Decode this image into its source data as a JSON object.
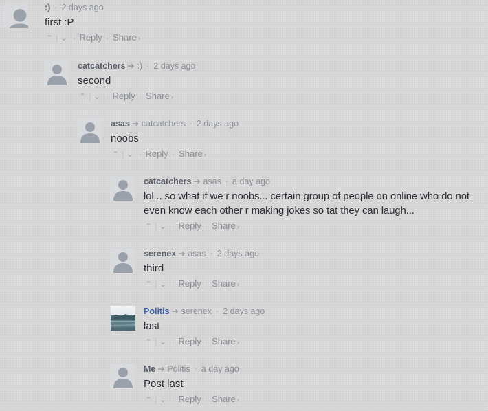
{
  "comments": [
    {
      "author": ":)",
      "in_reply_to": "",
      "time": "2 days ago",
      "text": "first :P",
      "reply": "Reply",
      "share": "Share",
      "avatar": "default"
    },
    {
      "author": "catcatchers",
      "in_reply_to": ":)",
      "time": "2 days ago",
      "text": "second",
      "reply": "Reply",
      "share": "Share",
      "avatar": "default"
    },
    {
      "author": "asas",
      "in_reply_to": "catcatchers",
      "time": "2 days ago",
      "text": "noobs",
      "reply": "Reply",
      "share": "Share",
      "avatar": "default"
    },
    {
      "author": "catcatchers",
      "in_reply_to": "asas",
      "time": "a day ago",
      "text": "lol... so what if we r noobs... certain group of people on online who do not even know each other r making jokes so tat they can laugh...",
      "reply": "Reply",
      "share": "Share",
      "avatar": "default"
    },
    {
      "author": "serenex",
      "in_reply_to": "asas",
      "time": "2 days ago",
      "text": "third",
      "reply": "Reply",
      "share": "Share",
      "avatar": "default"
    },
    {
      "author": "Politis",
      "in_reply_to": "serenex",
      "time": "2 days ago",
      "text": "last",
      "reply": "Reply",
      "share": "Share",
      "avatar": "photo"
    },
    {
      "author": "Me",
      "in_reply_to": "Politis",
      "time": "a day ago",
      "text": "Post last",
      "reply": "Reply",
      "share": "Share",
      "avatar": "default"
    }
  ],
  "icons": {
    "upvote": "chevron-up-icon",
    "downvote": "chevron-down-icon",
    "reply_arrow": "reply-arrow-icon",
    "share_chevron": "chevron-right-icon"
  },
  "colors": {
    "author": "#5b6169",
    "author_highlight": "#3f5fa8",
    "meta": "#8b9099",
    "text": "#2e3238"
  }
}
